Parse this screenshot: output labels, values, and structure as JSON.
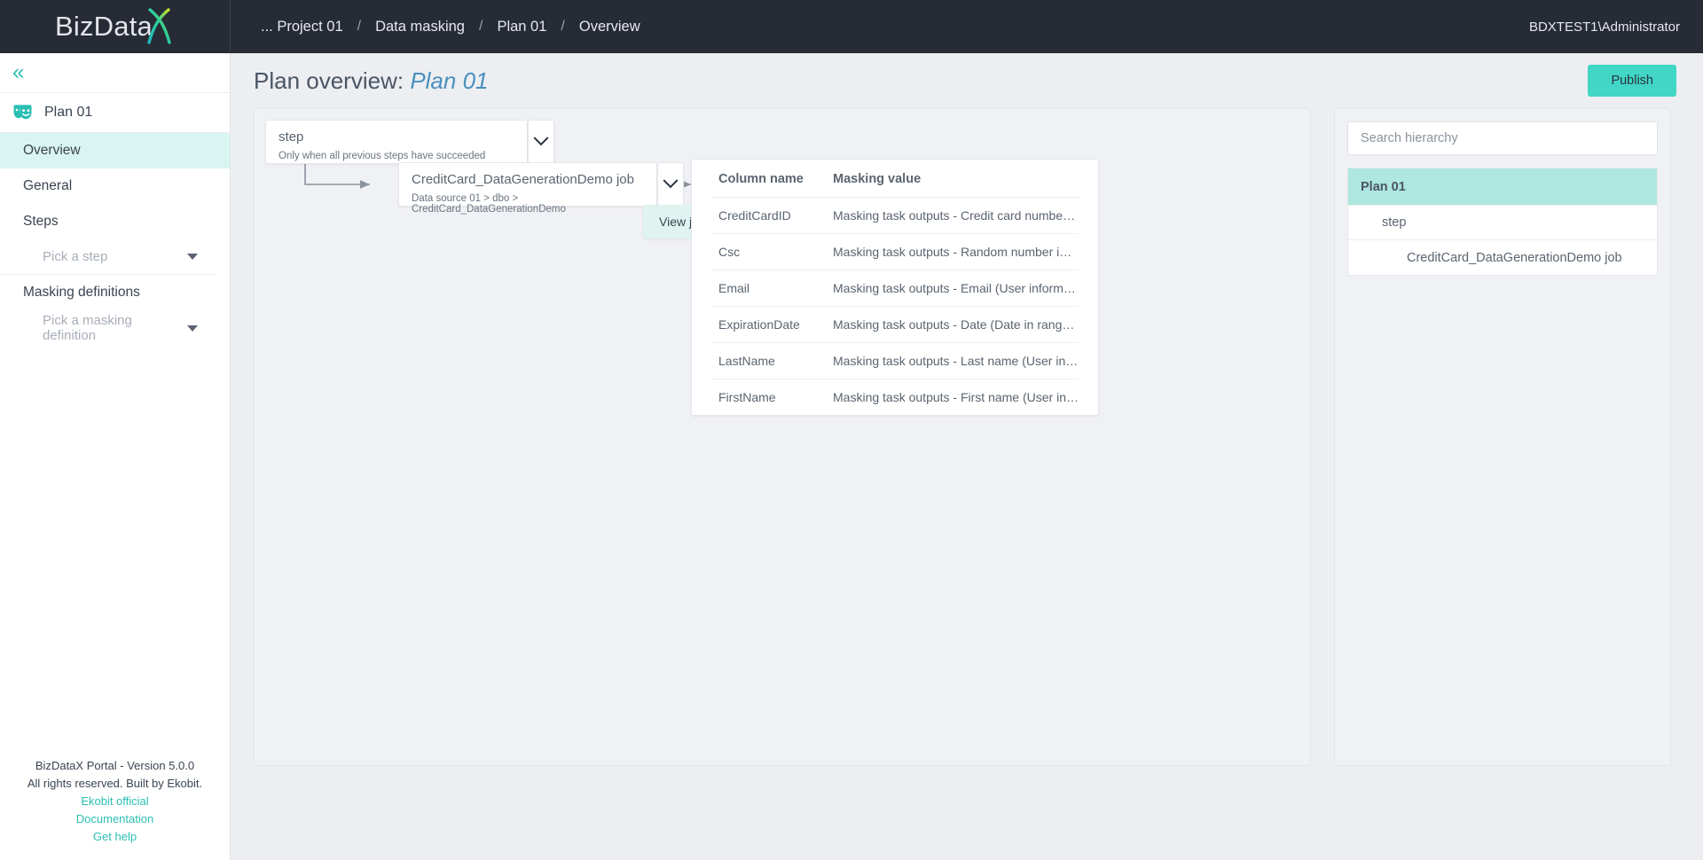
{
  "app": {
    "logo_text": "BizData",
    "logo_x_letter": "X",
    "user": "BDXTEST1\\Administrator",
    "accent_teal": "#41d6c6",
    "highlight_teal": "#aee7df",
    "nav_active_bg": "#d9f5f1",
    "topbar_bg": "#262b35",
    "title_blue": "#4a8fbc"
  },
  "breadcrumb": {
    "items": [
      {
        "label": "... Project 01"
      },
      {
        "label": "Data masking"
      },
      {
        "label": "Plan 01"
      },
      {
        "label": "Overview"
      }
    ],
    "separator": "/"
  },
  "sidebar": {
    "collapse_icon": "chevrons-left-icon",
    "plan": {
      "icon": "theater-masks-icon",
      "label": "Plan 01"
    },
    "items": [
      {
        "label": "Overview",
        "active": true
      },
      {
        "label": "General",
        "active": false
      },
      {
        "label": "Steps",
        "active": false
      }
    ],
    "step_picker": {
      "placeholder": "Pick a step",
      "caret": "caret-down-icon"
    },
    "masking_definitions_label": "Masking definitions",
    "masking_picker": {
      "placeholder": "Pick a masking definition",
      "caret": "caret-down-icon"
    },
    "footer": {
      "version": "BizDataX Portal - Version 5.0.0",
      "rights": "All rights reserved. Built by Ekobit.",
      "links": [
        "Ekobit official",
        "Documentation",
        "Get help"
      ]
    }
  },
  "page": {
    "title_prefix": "Plan overview: ",
    "title_plan": "Plan 01",
    "publish_label": "Publish"
  },
  "flow": {
    "step_card": {
      "title": "step",
      "subtitle": "Only when all previous steps have succeeded",
      "chevron": "chevron-down-icon"
    },
    "job_card": {
      "title": "CreditCard_DataGenerationDemo job",
      "subtitle": "Data source 01 > dbo > CreditCard_DataGenerationDemo",
      "chevron": "chevron-down-icon"
    },
    "tooltip": "View job details"
  },
  "columns_table": {
    "headers": [
      "Column name",
      "Masking value"
    ],
    "rows": [
      {
        "column": "CreditCardID",
        "masking": "Masking task outputs - Credit card numbe…"
      },
      {
        "column": "Csc",
        "masking": "Masking task outputs - Random number i…"
      },
      {
        "column": "Email",
        "masking": "Masking task outputs - Email (User inform…"
      },
      {
        "column": "ExpirationDate",
        "masking": "Masking task outputs - Date (Date in rang…"
      },
      {
        "column": "LastName",
        "masking": "Masking task outputs - Last name (User in…"
      },
      {
        "column": "FirstName",
        "masking": "Masking task outputs - First name (User in…"
      }
    ]
  },
  "hierarchy": {
    "search_placeholder": "Search hierarchy",
    "nodes": [
      {
        "label": "Plan 01",
        "depth": 0,
        "selected": true
      },
      {
        "label": "step",
        "depth": 1,
        "selected": false
      },
      {
        "label": "CreditCard_DataGenerationDemo job",
        "depth": 2,
        "selected": false
      }
    ]
  }
}
